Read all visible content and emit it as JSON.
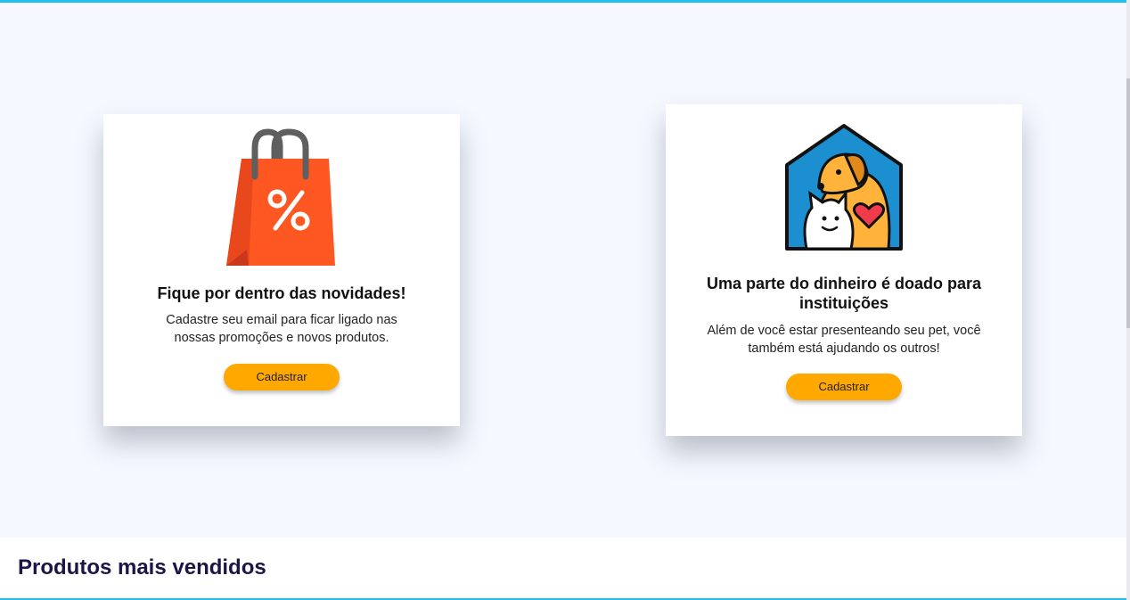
{
  "colors": {
    "accent_top_bar": "#1ec0f0",
    "hero_background": "#f5f8ff",
    "button": "#ffa800",
    "section_title": "#1c1545"
  },
  "cards": [
    {
      "icon": "shopping-bag-percent-icon",
      "title": "Fique por dentro das novidades!",
      "text": "Cadastre seu email para ficar ligado nas nossas promoções e novos produtos.",
      "button_label": "Cadastrar"
    },
    {
      "icon": "pet-house-heart-icon",
      "title": "Uma parte do dinheiro é doado para instituições",
      "text": "Além de você estar presenteando seu pet, você também está ajudando os outros!",
      "button_label": "Cadastrar"
    }
  ],
  "products_section": {
    "title": "Produtos mais vendidos"
  }
}
